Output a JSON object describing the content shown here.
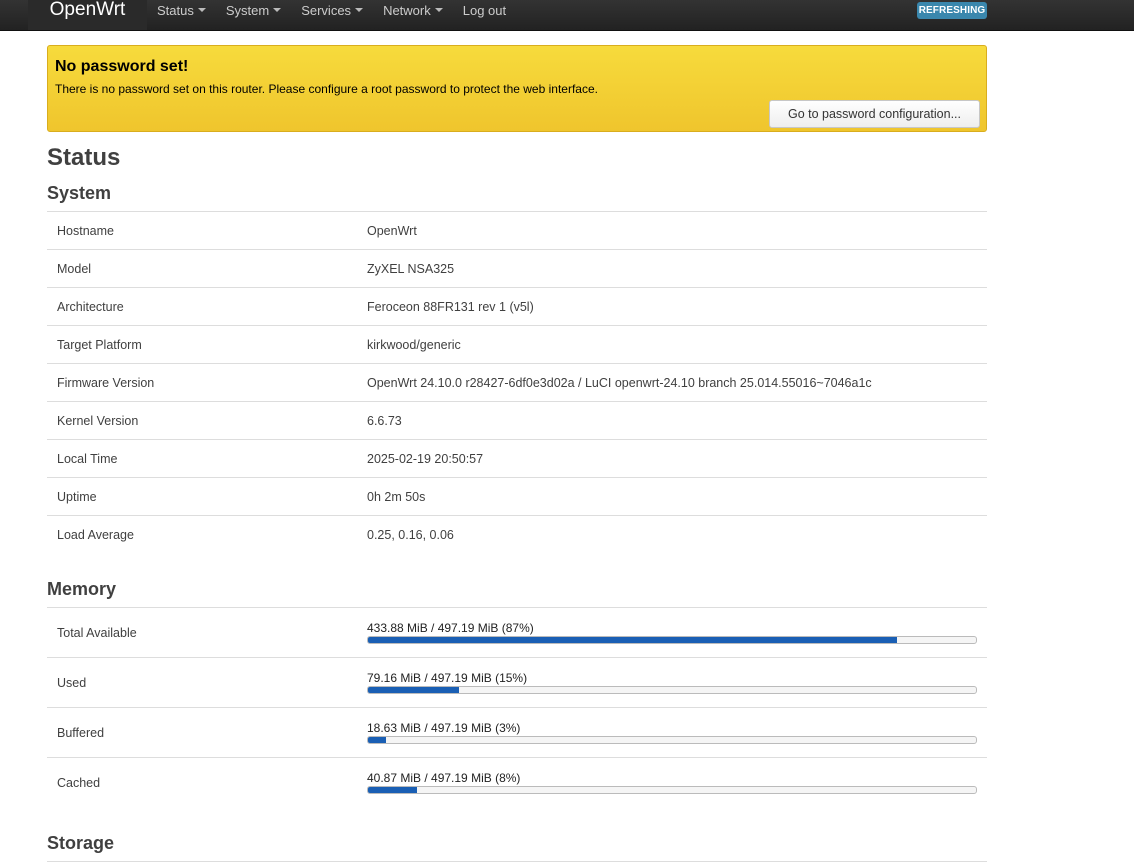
{
  "navbar": {
    "brand": "OpenWrt",
    "menu": [
      {
        "label": "Status",
        "dropdown": true
      },
      {
        "label": "System",
        "dropdown": true
      },
      {
        "label": "Services",
        "dropdown": true
      },
      {
        "label": "Network",
        "dropdown": true
      },
      {
        "label": "Log out",
        "dropdown": false
      }
    ],
    "badge": "REFRESHING"
  },
  "alert": {
    "title": "No password set!",
    "text": "There is no password set on this router. Please configure a root password to protect the web interface.",
    "button": "Go to password configuration..."
  },
  "page_title": "Status",
  "system": {
    "heading": "System",
    "rows": [
      {
        "label": "Hostname",
        "value": "OpenWrt"
      },
      {
        "label": "Model",
        "value": "ZyXEL NSA325"
      },
      {
        "label": "Architecture",
        "value": "Feroceon 88FR131 rev 1 (v5l)"
      },
      {
        "label": "Target Platform",
        "value": "kirkwood/generic"
      },
      {
        "label": "Firmware Version",
        "value": "OpenWrt 24.10.0 r28427-6df0e3d02a / LuCI openwrt-24.10 branch 25.014.55016~7046a1c"
      },
      {
        "label": "Kernel Version",
        "value": "6.6.73"
      },
      {
        "label": "Local Time",
        "value": "2025-02-19 20:50:57"
      },
      {
        "label": "Uptime",
        "value": "0h 2m 50s"
      },
      {
        "label": "Load Average",
        "value": "0.25, 0.16, 0.06"
      }
    ]
  },
  "memory": {
    "heading": "Memory",
    "rows": [
      {
        "label": "Total Available",
        "value": "433.88 MiB / 497.19 MiB (87%)",
        "percent": 87
      },
      {
        "label": "Used",
        "value": "79.16 MiB / 497.19 MiB (15%)",
        "percent": 15
      },
      {
        "label": "Buffered",
        "value": "18.63 MiB / 497.19 MiB (3%)",
        "percent": 3
      },
      {
        "label": "Cached",
        "value": "40.87 MiB / 497.19 MiB (8%)",
        "percent": 8
      }
    ]
  },
  "storage": {
    "heading": "Storage"
  },
  "colors": {
    "navbar": "#222222",
    "alert": "#f2cc31",
    "badge": "#3a87ad",
    "progress": "#1a5fb4"
  }
}
